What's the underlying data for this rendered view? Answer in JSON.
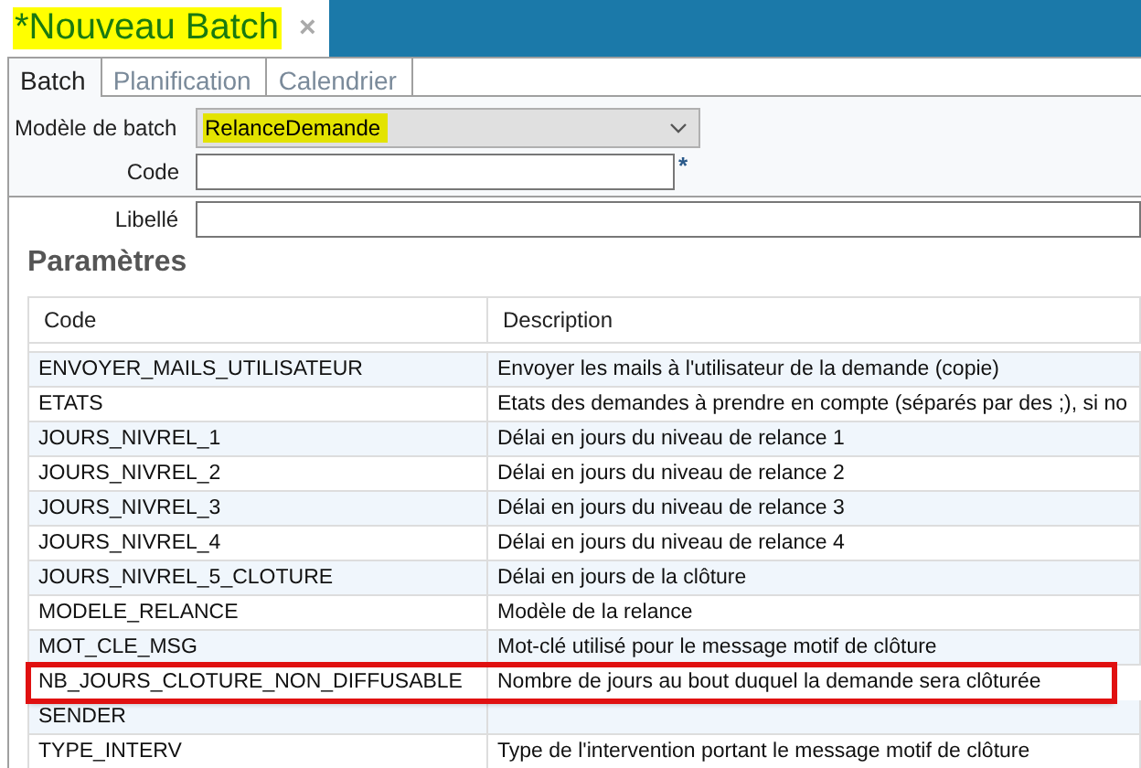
{
  "document_tab": {
    "title": "*Nouveau Batch",
    "highlighted": true,
    "close": "×"
  },
  "tabs": [
    {
      "label": "Batch",
      "selected": true
    },
    {
      "label": "Planification",
      "selected": false
    },
    {
      "label": "Calendrier",
      "selected": false
    }
  ],
  "form": {
    "model": {
      "label": "Modèle de batch",
      "value": "RelanceDemande",
      "highlighted": true
    },
    "code": {
      "label": "Code",
      "required_mark": "*"
    },
    "libelle": {
      "label": "Libellé"
    }
  },
  "parameters": {
    "title": "Paramètres",
    "columns": [
      "Code",
      "Description"
    ],
    "rows": [
      {
        "code": "ENVOYER_MAILS_UTILISATEUR",
        "description": "Envoyer les mails à l'utilisateur de la demande (copie)",
        "highlighted": false
      },
      {
        "code": "ETATS",
        "description": "Etats des demandes à prendre en compte (séparés par des ;), si no",
        "highlighted": false
      },
      {
        "code": "JOURS_NIVREL_1",
        "description": "Délai en jours du niveau de relance 1",
        "highlighted": false
      },
      {
        "code": "JOURS_NIVREL_2",
        "description": "Délai en jours du niveau de relance 2",
        "highlighted": false
      },
      {
        "code": "JOURS_NIVREL_3",
        "description": "Délai en jours du niveau de relance 3",
        "highlighted": false
      },
      {
        "code": "JOURS_NIVREL_4",
        "description": "Délai en jours du niveau de relance 4",
        "highlighted": false
      },
      {
        "code": "JOURS_NIVREL_5_CLOTURE",
        "description": "Délai en jours de la clôture",
        "highlighted": false
      },
      {
        "code": "MODELE_RELANCE",
        "description": "Modèle de la relance",
        "highlighted": false
      },
      {
        "code": "MOT_CLE_MSG",
        "description": "Mot-clé utilisé pour le message motif de clôture",
        "highlighted": false
      },
      {
        "code": "NB_JOURS_CLOTURE_NON_DIFFUSABLE",
        "description": "Nombre de jours au bout duquel la demande sera clôturée",
        "highlighted": true
      },
      {
        "code": "SENDER",
        "description": "",
        "highlighted": false
      },
      {
        "code": "TYPE_INTERV",
        "description": "Type de l'intervention portant le message motif de clôture",
        "highlighted": false
      }
    ]
  }
}
